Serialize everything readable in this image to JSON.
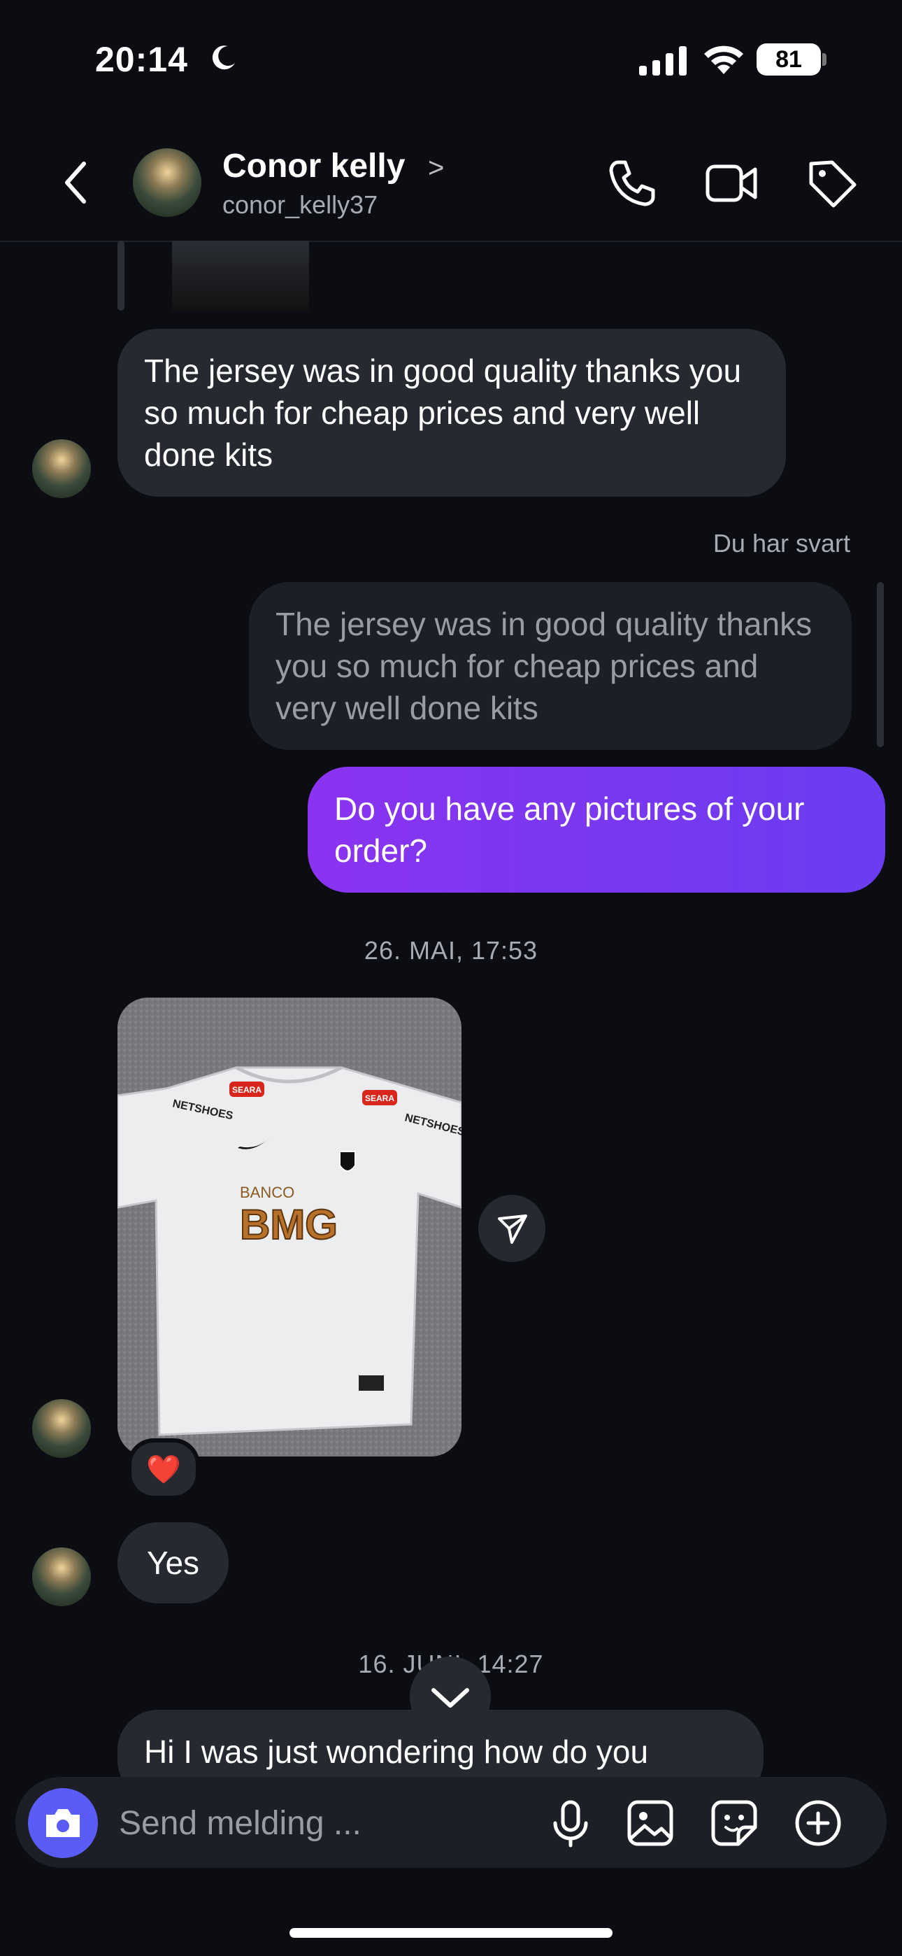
{
  "status_bar": {
    "time": "20:14",
    "battery": "81"
  },
  "header": {
    "name": "Conor kelly",
    "chevron": ">",
    "username": "conor_kelly37"
  },
  "messages": {
    "received_1": "The jersey was in good quality thanks you so much for cheap prices and very well done kits",
    "replied_label": "Du har svart",
    "quoted": "The jersey was in good quality thanks you so much for cheap prices and very well done kits",
    "sent_1": "Do you have any pictures of your order?",
    "date_1": "26. MAI, 17:53",
    "reaction": "❤️",
    "received_yes": "Yes",
    "date_2": "16. JUNI, 14:27",
    "received_last": "Hi I was just wondering how do you"
  },
  "photo": {
    "sponsor_top": "SEARA",
    "sleeve_left": "NETSHOES",
    "sleeve_right": "NETSHOES",
    "sponsor_small": "BANCO",
    "sponsor_main": "BMG"
  },
  "composer": {
    "placeholder": "Send melding ..."
  },
  "icons": [
    "moon-icon",
    "signal-icon",
    "wifi-icon",
    "back-icon",
    "phone-icon",
    "video-icon",
    "tag-icon",
    "send-icon",
    "chevron-down-icon",
    "camera-icon",
    "mic-icon",
    "gallery-icon",
    "sticker-icon",
    "plus-icon"
  ]
}
